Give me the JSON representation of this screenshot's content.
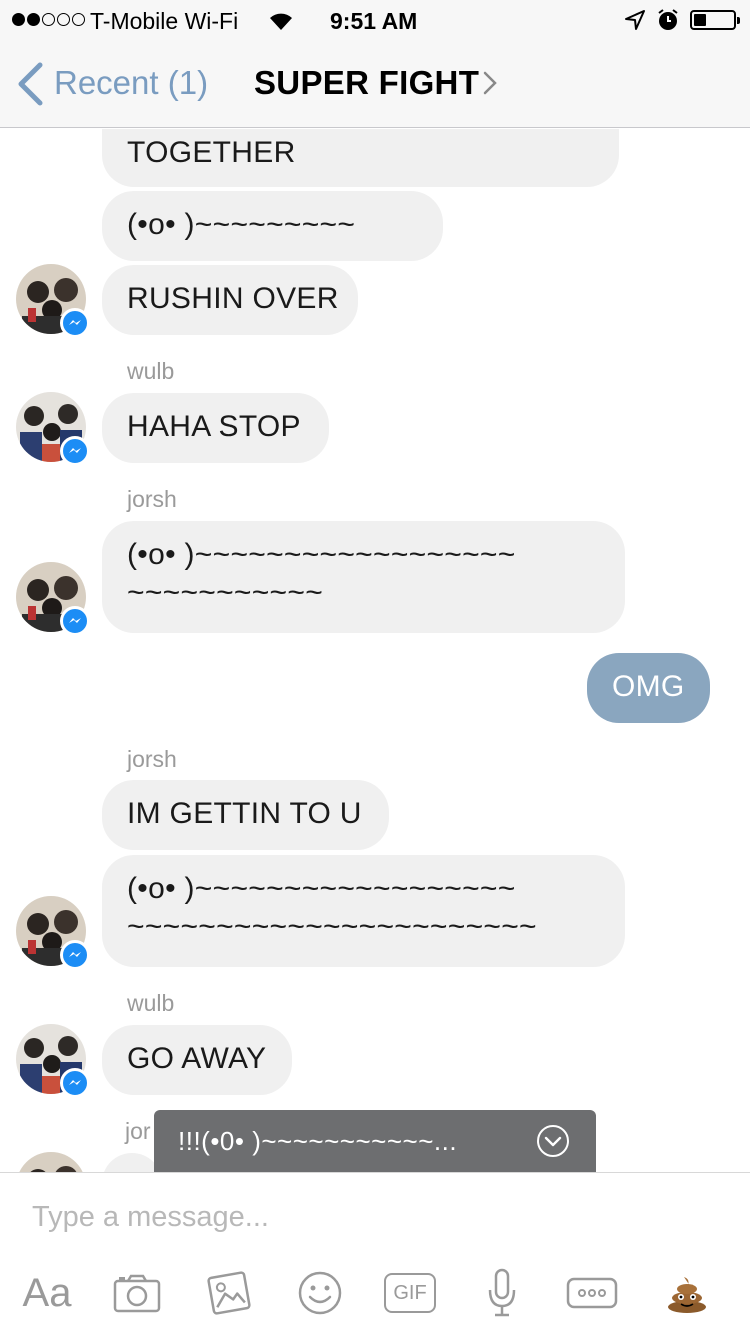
{
  "status_bar": {
    "carrier": "T-Mobile Wi-Fi",
    "time": "9:51 AM"
  },
  "nav": {
    "back_label": "Recent (1)",
    "title": "SUPER FIGHT"
  },
  "messages": [
    {
      "text": "TOGETHER"
    },
    {
      "text": "(•o•      )~~~~~~~~~"
    },
    {
      "text": "RUSHIN OVER"
    },
    {
      "sender": "wulb"
    },
    {
      "text": "HAHA STOP"
    },
    {
      "sender": "jorsh"
    },
    {
      "text": "(•o•      )~~~~~~~~~~~~~~~~~~",
      "text2": "~~~~~~~~~~~"
    },
    {
      "text": "OMG"
    },
    {
      "sender": "jorsh"
    },
    {
      "text": "IM GETTIN TO U"
    },
    {
      "text": "(•o•      )~~~~~~~~~~~~~~~~~~",
      "text2": "~~~~~~~~~~~~~~~~~~~~~~~"
    },
    {
      "sender": "wulb"
    },
    {
      "text": "GO AWAY"
    },
    {
      "sender": "jor"
    }
  ],
  "suggestion": {
    "text": "!!!(•0•      )~~~~~~~~~~~..."
  },
  "composer": {
    "placeholder": "Type a message...",
    "aa_label": "Aa",
    "gif_label": "GIF",
    "icons": [
      "camera-icon",
      "gallery-icon",
      "emoji-icon",
      "gif-icon",
      "microphone-icon",
      "more-icon",
      "poop-emoji-icon"
    ]
  },
  "colors": {
    "outgoing_bubble": "#8aa6bf",
    "incoming_bubble": "#f0f0f0",
    "messenger_badge": "#1c8df5",
    "nav_link": "#7a9cc0"
  }
}
